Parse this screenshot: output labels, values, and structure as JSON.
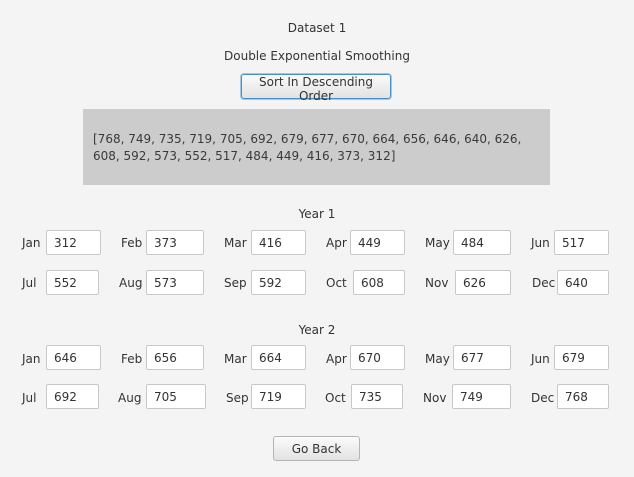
{
  "header": {
    "dataset_title": "Dataset 1",
    "method_title": "Double Exponential Smoothing",
    "sort_button_label": "Sort In Descending Order"
  },
  "sorted_output": "[768, 749, 735, 719, 705, 692, 679, 677, 670, 664, 656, 646, 640, 626, 608, 592, 573, 552, 517, 484, 449, 416, 373, 312]",
  "year1": {
    "title": "Year 1",
    "months": [
      {
        "label": "Jan",
        "value": "312"
      },
      {
        "label": "Feb",
        "value": "373"
      },
      {
        "label": "Mar",
        "value": "416"
      },
      {
        "label": "Apr",
        "value": "449"
      },
      {
        "label": "May",
        "value": "484"
      },
      {
        "label": "Jun",
        "value": "517"
      },
      {
        "label": "Jul",
        "value": "552"
      },
      {
        "label": "Aug",
        "value": "573"
      },
      {
        "label": "Sep",
        "value": "592"
      },
      {
        "label": "Oct",
        "value": "608"
      },
      {
        "label": "Nov",
        "value": "626"
      },
      {
        "label": "Dec",
        "value": "640"
      }
    ]
  },
  "year2": {
    "title": "Year 2",
    "months": [
      {
        "label": "Jan",
        "value": "646"
      },
      {
        "label": "Feb",
        "value": "656"
      },
      {
        "label": "Mar",
        "value": "664"
      },
      {
        "label": "Apr",
        "value": "670"
      },
      {
        "label": "May",
        "value": "677"
      },
      {
        "label": "Jun",
        "value": "679"
      },
      {
        "label": "Jul",
        "value": "692"
      },
      {
        "label": "Aug",
        "value": "705"
      },
      {
        "label": "Sep",
        "value": "719"
      },
      {
        "label": "Oct",
        "value": "735"
      },
      {
        "label": "Nov",
        "value": "749"
      },
      {
        "label": "Dec",
        "value": "768"
      }
    ]
  },
  "footer": {
    "back_button_label": "Go Back"
  }
}
